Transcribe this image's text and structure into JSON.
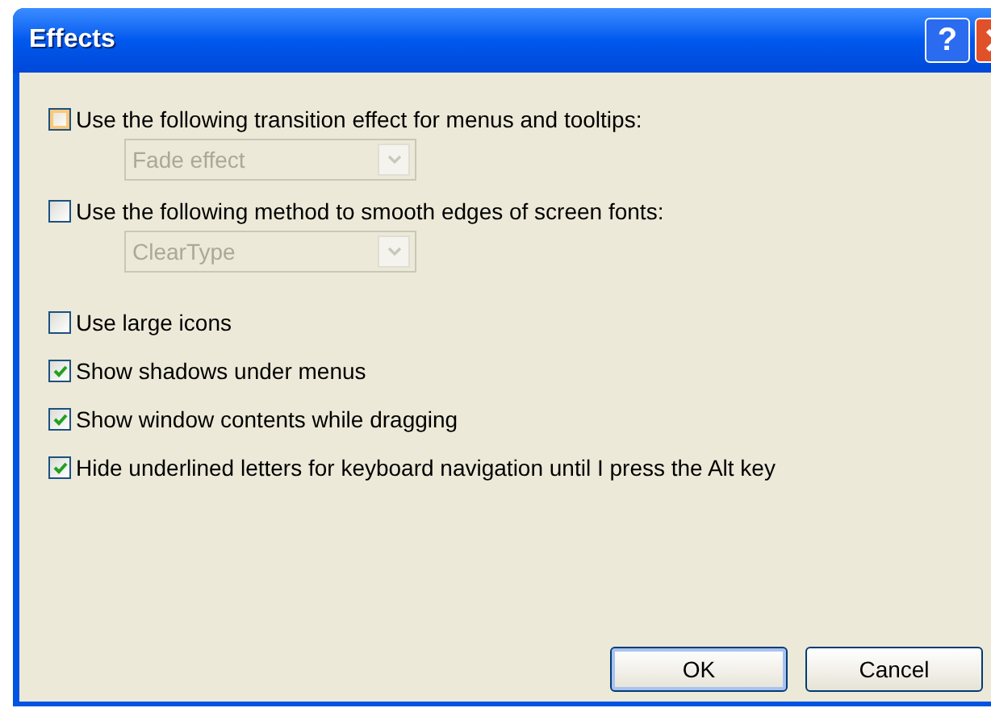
{
  "window": {
    "title": "Effects",
    "help_button": "?"
  },
  "options": [
    {
      "label": "Use the following transition effect for menus and tooltips:",
      "checked": false,
      "hovered": true,
      "dropdown": {
        "value": "Fade effect",
        "disabled": true
      }
    },
    {
      "label": "Use the following method to smooth edges of screen fonts:",
      "checked": false,
      "hovered": false,
      "dropdown": {
        "value": "ClearType",
        "disabled": true
      }
    },
    {
      "label": "Use large icons",
      "checked": false,
      "hovered": false
    },
    {
      "label": "Show shadows under menus",
      "checked": true,
      "hovered": false
    },
    {
      "label": "Show window contents while dragging",
      "checked": true,
      "hovered": false
    },
    {
      "label": "Hide underlined letters for keyboard navigation until I press the Alt key",
      "checked": true,
      "hovered": false
    }
  ],
  "buttons": [
    {
      "label": "OK",
      "default": true
    },
    {
      "label": "Cancel",
      "default": false
    }
  ]
}
